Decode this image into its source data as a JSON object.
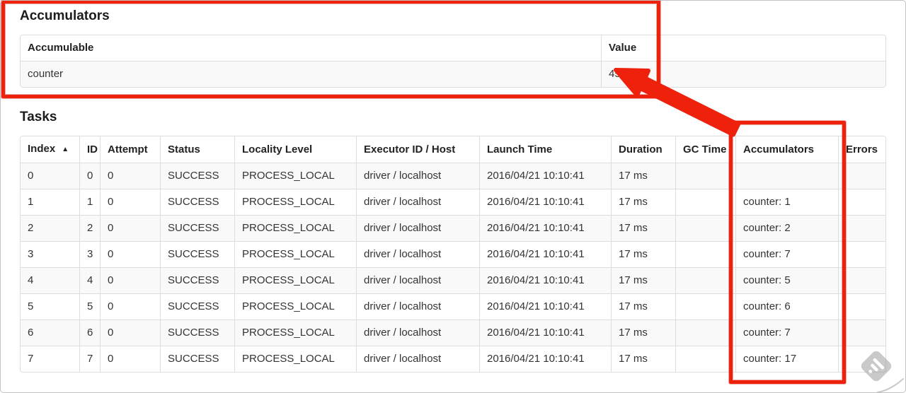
{
  "annotation": {
    "color": "#ee220c"
  },
  "accumulators_section": {
    "title": "Accumulators",
    "headers": [
      "Accumulable",
      "Value"
    ],
    "rows": [
      [
        "counter",
        "45"
      ]
    ]
  },
  "tasks_section": {
    "title": "Tasks",
    "sort_indicator": "▲",
    "headers": [
      "Index",
      "ID",
      "Attempt",
      "Status",
      "Locality Level",
      "Executor ID / Host",
      "Launch Time",
      "Duration",
      "GC Time",
      "Accumulators",
      "Errors"
    ],
    "rows": [
      [
        "0",
        "0",
        "0",
        "SUCCESS",
        "PROCESS_LOCAL",
        "driver / localhost",
        "2016/04/21 10:10:41",
        "17 ms",
        "",
        "",
        ""
      ],
      [
        "1",
        "1",
        "0",
        "SUCCESS",
        "PROCESS_LOCAL",
        "driver / localhost",
        "2016/04/21 10:10:41",
        "17 ms",
        "",
        "counter: 1",
        ""
      ],
      [
        "2",
        "2",
        "0",
        "SUCCESS",
        "PROCESS_LOCAL",
        "driver / localhost",
        "2016/04/21 10:10:41",
        "17 ms",
        "",
        "counter: 2",
        ""
      ],
      [
        "3",
        "3",
        "0",
        "SUCCESS",
        "PROCESS_LOCAL",
        "driver / localhost",
        "2016/04/21 10:10:41",
        "17 ms",
        "",
        "counter: 7",
        ""
      ],
      [
        "4",
        "4",
        "0",
        "SUCCESS",
        "PROCESS_LOCAL",
        "driver / localhost",
        "2016/04/21 10:10:41",
        "17 ms",
        "",
        "counter: 5",
        ""
      ],
      [
        "5",
        "5",
        "0",
        "SUCCESS",
        "PROCESS_LOCAL",
        "driver / localhost",
        "2016/04/21 10:10:41",
        "17 ms",
        "",
        "counter: 6",
        ""
      ],
      [
        "6",
        "6",
        "0",
        "SUCCESS",
        "PROCESS_LOCAL",
        "driver / localhost",
        "2016/04/21 10:10:41",
        "17 ms",
        "",
        "counter: 7",
        ""
      ],
      [
        "7",
        "7",
        "0",
        "SUCCESS",
        "PROCESS_LOCAL",
        "driver / localhost",
        "2016/04/21 10:10:41",
        "17 ms",
        "",
        "counter: 17",
        ""
      ]
    ]
  }
}
